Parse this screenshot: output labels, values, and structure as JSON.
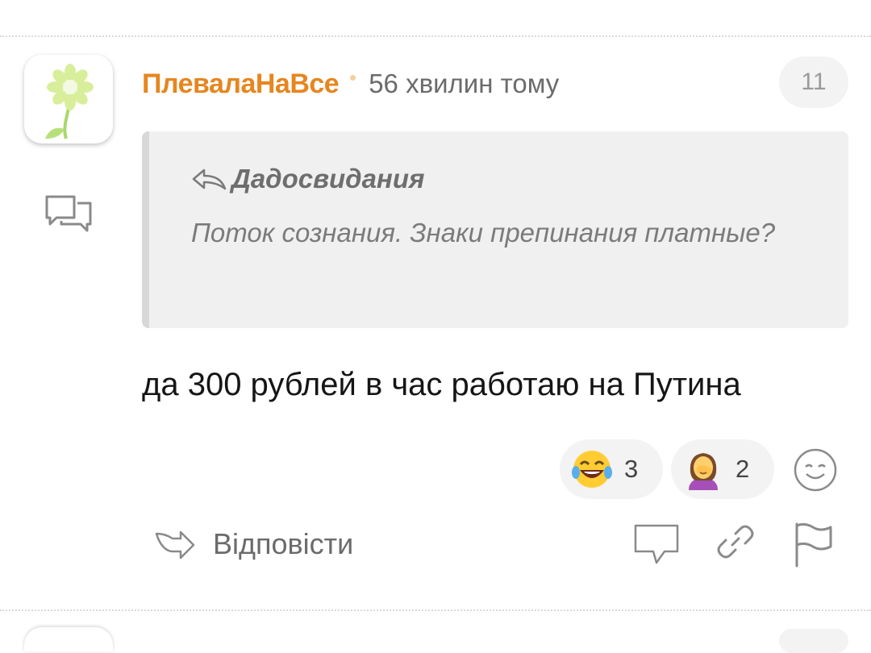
{
  "comment": {
    "author": "ПлевалаНаВсе",
    "time": "56 хвилин тому",
    "vote_count": "11",
    "quote": {
      "author": "Дадосвидания",
      "text": "Поток сознания. Знаки препинания платные?"
    },
    "body": "да 300 рублей в час работаю на Путина",
    "reactions": [
      {
        "icon": "tears-of-joy-emoji",
        "count": "3"
      },
      {
        "icon": "facepalm-woman-emoji",
        "count": "2"
      }
    ],
    "actions": {
      "reply_label": "Відповісти"
    }
  },
  "colors": {
    "author": "#e6861f",
    "quote_bg": "#f0f0f0",
    "text": "#151515",
    "muted": "#6b6b6b"
  }
}
